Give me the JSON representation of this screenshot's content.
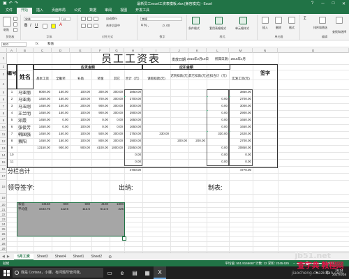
{
  "window": {
    "title": "最新员工excel工资表模板.xlsx  [兼容模式] - Excel",
    "qat": [
      "save-icon",
      "undo-icon",
      "redo-icon"
    ],
    "controls": [
      "?",
      "─",
      "□",
      "✕"
    ]
  },
  "ribbon": {
    "tabs": [
      "文件",
      "开始",
      "插入",
      "页面布局",
      "公式",
      "数据",
      "审阅",
      "视图",
      "开发工具"
    ],
    "active_tab": "开始",
    "font_name": "宋体",
    "font_size": "12",
    "number_format": "常规",
    "groups": [
      "剪贴板",
      "字体",
      "对齐方式",
      "数字",
      "样式",
      "单元格",
      "编辑"
    ],
    "buttons": {
      "paste": "粘贴",
      "wrap": "自动换行",
      "merge": "合并后居中",
      "cond": "条件格式",
      "table": "套用表格格式",
      "cellstyle": "单元格样式",
      "insert": "插入",
      "delete": "删除",
      "format": "格式",
      "sortfilter": "排序和筛选",
      "findselect": "查找和选择"
    }
  },
  "formula_bar": {
    "name_box": "B20",
    "fx": "fx",
    "value": "和值"
  },
  "columns": [
    "A",
    "B",
    "C",
    "D",
    "E",
    "F",
    "G",
    "H",
    "I",
    "J",
    "K",
    "L",
    "M",
    "N",
    "O"
  ],
  "rows": [
    "1",
    "2",
    "3",
    "4",
    "5",
    "6",
    "7",
    "8",
    "9",
    "10",
    "11",
    "12",
    "13",
    "14",
    "15",
    "16",
    "17",
    "18",
    "19",
    "20",
    "21",
    "22",
    "23",
    "24",
    "25",
    "26",
    "27",
    "28",
    "29",
    "30"
  ],
  "table": {
    "title": "员工工资表",
    "issue_label": "发放日期",
    "issue_date": "2015年2月10日",
    "period": "所属日期：2015年1月",
    "h_no": "编号",
    "h_name": "姓名",
    "h_sign": "签字",
    "h_payable": "应发金额",
    "h_deduct": "应扣金额",
    "cols": [
      "基本工资",
      "全勤奖",
      "补助",
      "奖金",
      "其它",
      "合计（元）",
      "请假扣款(元)",
      "迟到扣款(元)",
      "其它扣款(元)",
      "应扣合计（元）",
      "实发工资(元)"
    ],
    "rows": [
      {
        "no": "1",
        "name": "马亚丽",
        "v": [
          "8000.00",
          "150.00",
          "100.00",
          "300.00",
          "300.00",
          "3850.00",
          "",
          "",
          "",
          "",
          "3850.00"
        ]
      },
      {
        "no": "2",
        "name": "马亚南",
        "v": [
          "1450.00",
          "150.00",
          "100.00",
          "700.00",
          "300.00",
          "2700.00",
          "",
          "",
          "",
          "0.00",
          "2700.00"
        ]
      },
      {
        "no": "3",
        "name": "马玉刚",
        "v": [
          "1450.00",
          "150.00",
          "200.00",
          "900.00",
          "300.00",
          "3000.00",
          "",
          "",
          "",
          "0.00",
          "3000.00"
        ]
      },
      {
        "no": "4",
        "name": "王兰明",
        "v": [
          "1450.00",
          "150.00",
          "100.00",
          "900.00",
          "300.00",
          "2900.00",
          "",
          "",
          "",
          "0.00",
          "2900.00"
        ]
      },
      {
        "no": "5",
        "name": "邓霞",
        "v": [
          "1450.00",
          "0.00",
          "100.00",
          "0.00",
          "0.00",
          "1650.00",
          "",
          "",
          "",
          "0.00",
          "1650.00"
        ]
      },
      {
        "no": "6",
        "name": "张俊芳",
        "v": [
          "1450.00",
          "0.00",
          "100.00",
          "0.00",
          "0.00",
          "1650.00",
          "",
          "",
          "",
          "0.00",
          "1650.00"
        ]
      },
      {
        "no": "7",
        "name": "韩国强",
        "v": [
          "1450.00",
          "150.00",
          "100.00",
          "500.00",
          "300.00",
          "2750.00",
          "330.00",
          "",
          "",
          "330.00",
          "2420.00"
        ]
      },
      {
        "no": "8",
        "name": "蔡阳",
        "v": [
          "1450.00",
          "150.00",
          "100.00",
          "800.00",
          "300.00",
          "2900.00",
          "",
          "200.00",
          "200.00",
          "",
          "2700.00"
        ]
      },
      {
        "no": "9",
        "name": "",
        "v": [
          "13150.00",
          "900.00",
          "900.00",
          "4100.00",
          "1800.00",
          "23850.00",
          "",
          "",
          "",
          "0.00",
          "20850.00"
        ]
      },
      {
        "no": "10",
        "name": "",
        "v": [
          "",
          "",
          "",
          "",
          "",
          "0.00",
          "",
          "",
          "",
          "0.00",
          "0.00"
        ]
      },
      {
        "no": "11",
        "name": "",
        "v": [
          "",
          "",
          "",
          "",
          "",
          "0.00",
          "",
          "",
          "",
          "0.00",
          "0.00"
        ]
      }
    ],
    "subtotal_label": "分栏合计",
    "subtotal_total": "4700.00",
    "subtotal_net": "4770.00",
    "sign_leader": "领导签字:",
    "sign_cashier": "出纳:",
    "sign_maker": "制表:"
  },
  "stats": {
    "sum_label": "和值",
    "sum": [
      "13150",
      "900",
      "900",
      "4100",
      "1800"
    ],
    "avg_label": "平均值",
    "avg": [
      "1643.75",
      "112.5",
      "112.5",
      "512.5",
      "225"
    ]
  },
  "sheet_tabs": [
    "5月工资",
    "Sheet3",
    "Sheet4",
    "Sheet1",
    "Sheet2"
  ],
  "active_sheet": "5月工资",
  "add_sheet": "⊕",
  "status": {
    "ready": "就绪",
    "aggregate": "平均值: 551.9166667  计数: 12  求和: 2345.625",
    "zoom": "100%"
  },
  "taskbar": {
    "search": "我是 Cortana，小娜。有问题尽管问我。",
    "time": "16:24",
    "date": "2017/4/16",
    "lang": "中"
  },
  "watermark": {
    "site1": "jb51.net",
    "site2": "查字典 教程网",
    "url": "jiaocheng.chazidian.com"
  }
}
